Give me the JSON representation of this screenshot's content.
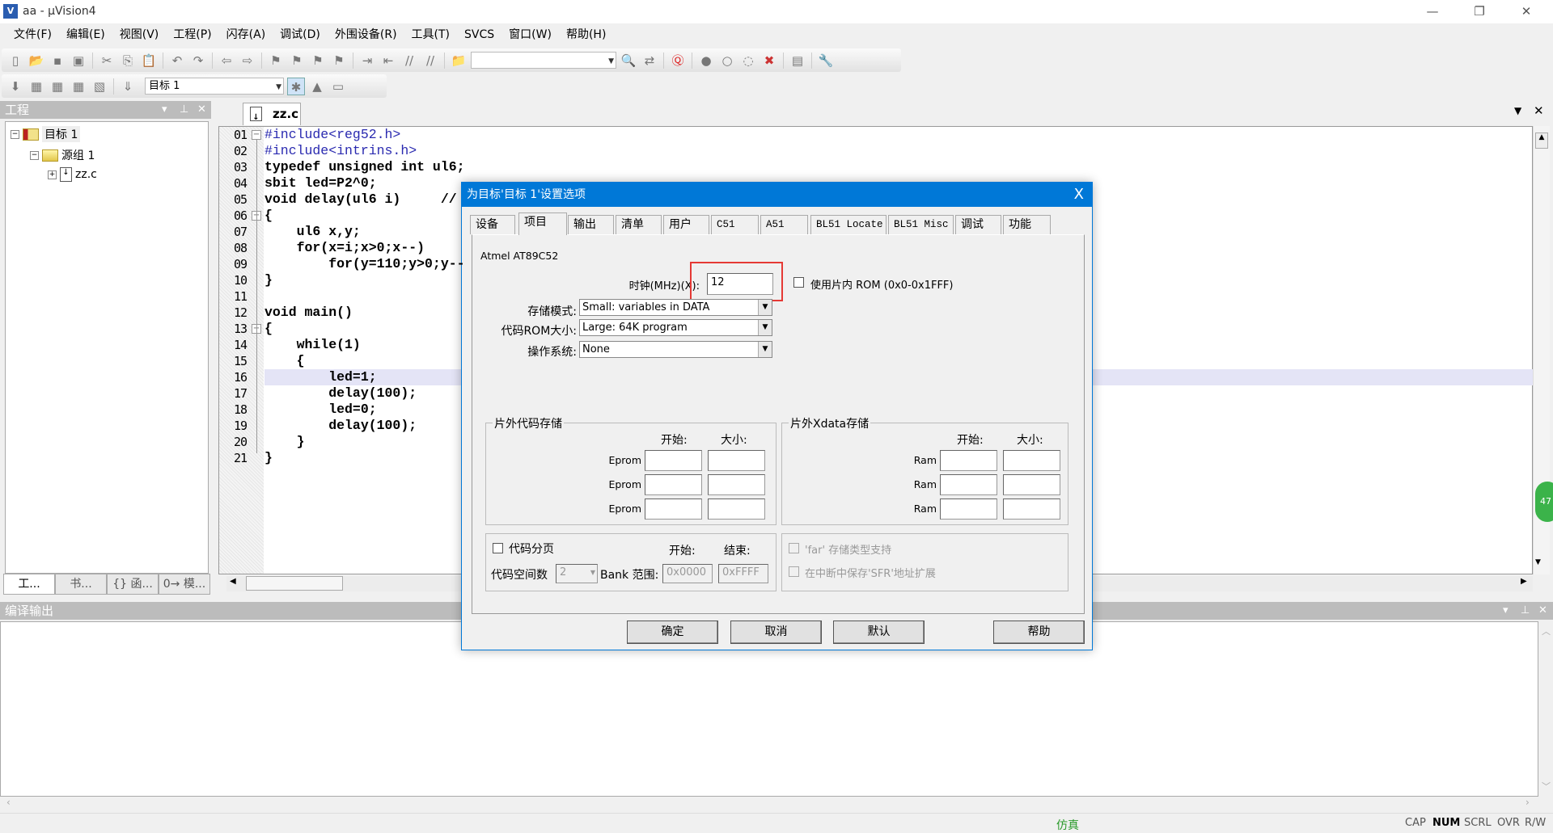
{
  "window": {
    "title": "aa - µVision4",
    "minimize": "—",
    "restore": "❐",
    "close": "✕"
  },
  "menu": [
    "文件(F)",
    "编辑(E)",
    "视图(V)",
    "工程(P)",
    "闪存(A)",
    "调试(D)",
    "外围设备(R)",
    "工具(T)",
    "SVCS",
    "窗口(W)",
    "帮助(H)"
  ],
  "toolbar1": [
    "new-file",
    "open-folder",
    "save",
    "save-all",
    "sep",
    "cut",
    "copy",
    "paste",
    "sep",
    "undo",
    "redo",
    "sep",
    "nav-back",
    "nav-forward",
    "sep",
    "bookmark-toggle",
    "bookmark-prev",
    "bookmark-next",
    "bookmark-clear",
    "sep",
    "indent",
    "unindent",
    "comment",
    "uncomment",
    "sep",
    "find-in-files",
    "COMBO",
    "find",
    "find-replace",
    "sep",
    "debug-start",
    "sep",
    "breakpoint-insert",
    "breakpoint-enable",
    "breakpoint-disable",
    "breakpoint-kill",
    "sep",
    "window-layout",
    "sep",
    "wrench"
  ],
  "toolbar2": {
    "icons": [
      "translate",
      "build",
      "rebuild",
      "batch-build",
      "stop-build",
      "sep",
      "download"
    ],
    "target_select": "目标 1",
    "icons2": [
      "target-options",
      "manage-components",
      "file-extensions"
    ]
  },
  "project_panel": {
    "title": "工程",
    "tree": {
      "target": "目标 1",
      "group": "源组 1",
      "file": "zz.c"
    },
    "tabs": [
      "工...",
      "书...",
      "{} 函...",
      "0→ 模..."
    ]
  },
  "editor": {
    "tab": "zz.c",
    "highlight_line": 16,
    "lines": [
      "#include<reg52.h>",
      "#include<intrins.h>",
      "typedef unsigned int ul6;",
      "sbit led=P2^0;",
      "void delay(ul6 i)     // ",
      "{",
      "    ul6 x,y;",
      "    for(x=i;x>0;x--)",
      "        for(y=110;y>0;y--",
      "}",
      "",
      "void main()",
      "{",
      "    while(1)",
      "    {",
      "        led=1;",
      "        delay(100);",
      "        led=0;",
      "        delay(100);",
      "    }",
      "}"
    ],
    "line_numbers": [
      "01",
      "02",
      "03",
      "04",
      "05",
      "06",
      "07",
      "08",
      "09",
      "10",
      "11",
      "12",
      "13",
      "14",
      "15",
      "16",
      "17",
      "18",
      "19",
      "20",
      "21"
    ]
  },
  "output_panel": {
    "title": "编译输出"
  },
  "status": {
    "mode": "仿真",
    "indicators": [
      "CAP",
      "NUM",
      "SCRL",
      "OVR",
      "R/W"
    ]
  },
  "dialog": {
    "title": "为目标'目标 1'设置选项",
    "close": "X",
    "tabs": [
      "设备",
      "项目",
      "输出",
      "清单",
      "用户",
      "C51",
      "A51",
      "BL51 Locate",
      "BL51 Misc",
      "调试",
      "功能"
    ],
    "active_tab": "项目",
    "device": "Atmel AT89C52",
    "clock_label": "时钟(MHz)(X):",
    "clock_value": "12",
    "use_onchip_rom": {
      "label": "使用片内 ROM (0x0-0x1FFF)",
      "checked": false
    },
    "memory_model_label": "存储模式:",
    "memory_model": "Small: variables in DATA",
    "code_rom_label": "代码ROM大小:",
    "code_rom": "Large: 64K program",
    "os_label": "操作系统:",
    "os": "None",
    "offchip_code": {
      "title": "片外代码存储",
      "start": "开始:",
      "size": "大小:",
      "rows": [
        "Eprom",
        "Eprom",
        "Eprom"
      ]
    },
    "offchip_xdata": {
      "title": "片外Xdata存储",
      "start": "开始:",
      "size": "大小:",
      "rows": [
        "Ram",
        "Ram",
        "Ram"
      ]
    },
    "code_banking": {
      "label": "代码分页",
      "checked": false,
      "start": "开始:",
      "end": "结束:",
      "banks_label": "代码空间数",
      "banks": "2",
      "range_label": "Bank 范围:",
      "range_start": "0x0000",
      "range_end": "0xFFFF"
    },
    "far_support": "'far' 存储类型支持",
    "save_sfr": "在中断中保存'SFR'地址扩展",
    "buttons": {
      "ok": "确定",
      "cancel": "取消",
      "default": "默认",
      "help": "帮助"
    }
  },
  "colors": {
    "dialog_title": "#0078d7",
    "highlight": "#e4e4f6",
    "status_mode": "#2a9a2a",
    "callout": "#e53935"
  }
}
